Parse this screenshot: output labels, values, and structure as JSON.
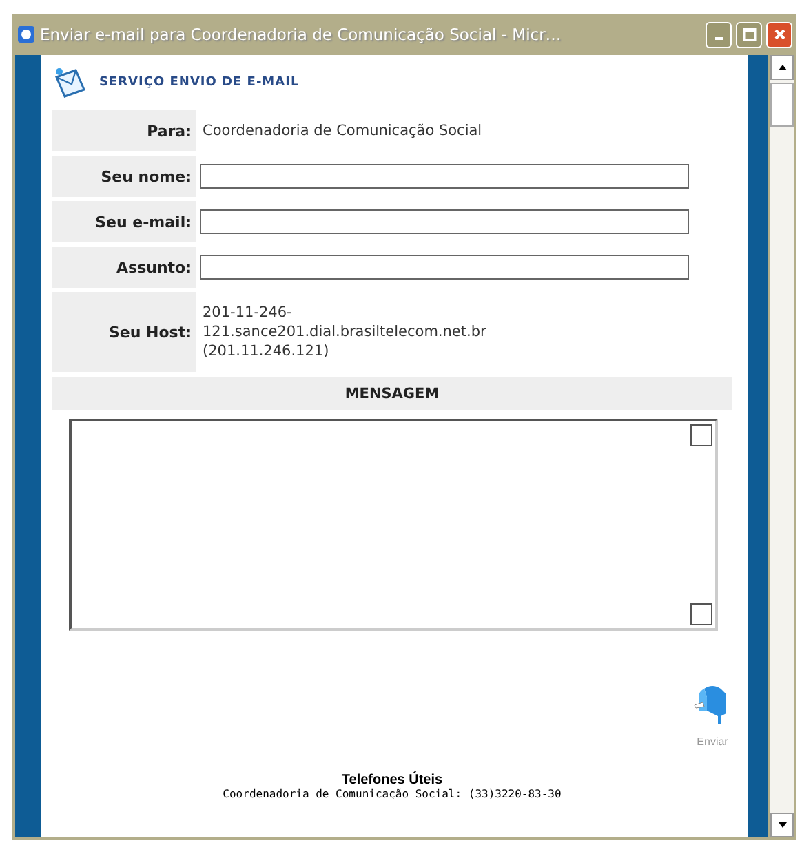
{
  "window": {
    "title": "Enviar e-mail para Coordenadoria de Comunicação Social - Micr…"
  },
  "header": {
    "title": "SERVIÇO ENVIO DE E-MAIL"
  },
  "form": {
    "rows": [
      {
        "kind": "text",
        "label": "Para:",
        "value": "Coordenadoria de Comunicação Social"
      },
      {
        "kind": "input",
        "label": "Seu nome:"
      },
      {
        "kind": "input",
        "label": "Seu e-mail:"
      },
      {
        "kind": "input",
        "label": "Assunto:"
      },
      {
        "kind": "text",
        "label": "Seu Host:",
        "value": "201-11-246-121.sance201.dial.brasiltelecom.net.br (201.11.246.121)"
      }
    ],
    "message_label": "MENSAGEM"
  },
  "send_button": {
    "label": "Enviar"
  },
  "footer": {
    "title": "Telefones Úteis",
    "line": "Coordenadoria de Comunicação Social: (33)3220-83-30"
  }
}
